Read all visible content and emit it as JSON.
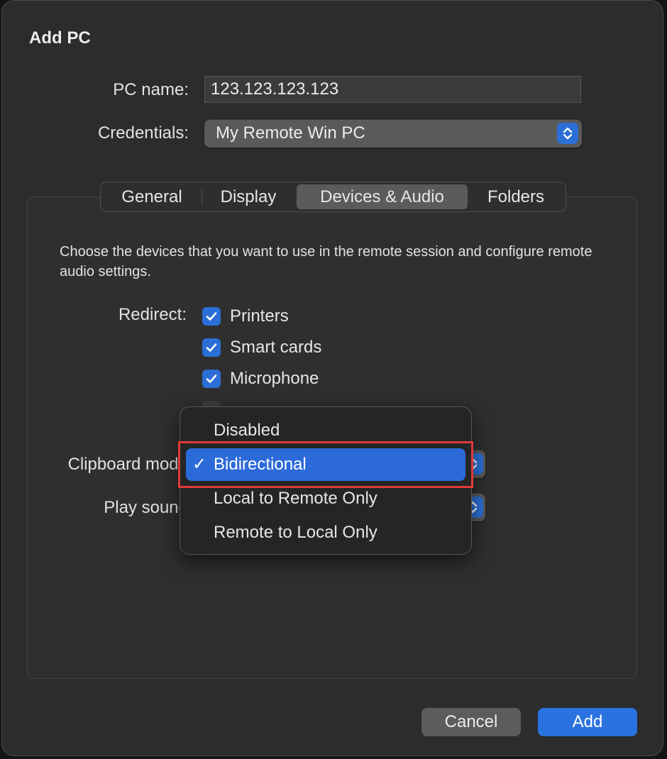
{
  "dialog": {
    "title": "Add PC",
    "pc_name_label": "PC name:",
    "pc_name_value": "123.123.123.123",
    "credentials_label": "Credentials:",
    "credentials_value": "My Remote Win PC"
  },
  "tabs": [
    {
      "label": "General",
      "active": false
    },
    {
      "label": "Display",
      "active": false
    },
    {
      "label": "Devices & Audio",
      "active": true
    },
    {
      "label": "Folders",
      "active": false
    }
  ],
  "devices": {
    "description": "Choose the devices that you want to use in the remote session and configure remote audio settings.",
    "redirect_label": "Redirect:",
    "items": [
      {
        "label": "Printers",
        "checked": true
      },
      {
        "label": "Smart cards",
        "checked": true
      },
      {
        "label": "Microphone",
        "checked": true
      }
    ],
    "clipboard_label": "Clipboard mode",
    "play_sound_label": "Play sound"
  },
  "clipboard_menu": {
    "options": [
      {
        "label": "Disabled",
        "selected": false
      },
      {
        "label": "Bidirectional",
        "selected": true
      },
      {
        "label": "Local to Remote Only",
        "selected": false
      },
      {
        "label": "Remote to Local Only",
        "selected": false
      }
    ],
    "check_glyph": "✓"
  },
  "buttons": {
    "cancel": "Cancel",
    "add": "Add"
  },
  "colors": {
    "accent": "#2b6fd6",
    "selection": "#2c6ad9",
    "highlight_outline": "#e03a3a"
  }
}
